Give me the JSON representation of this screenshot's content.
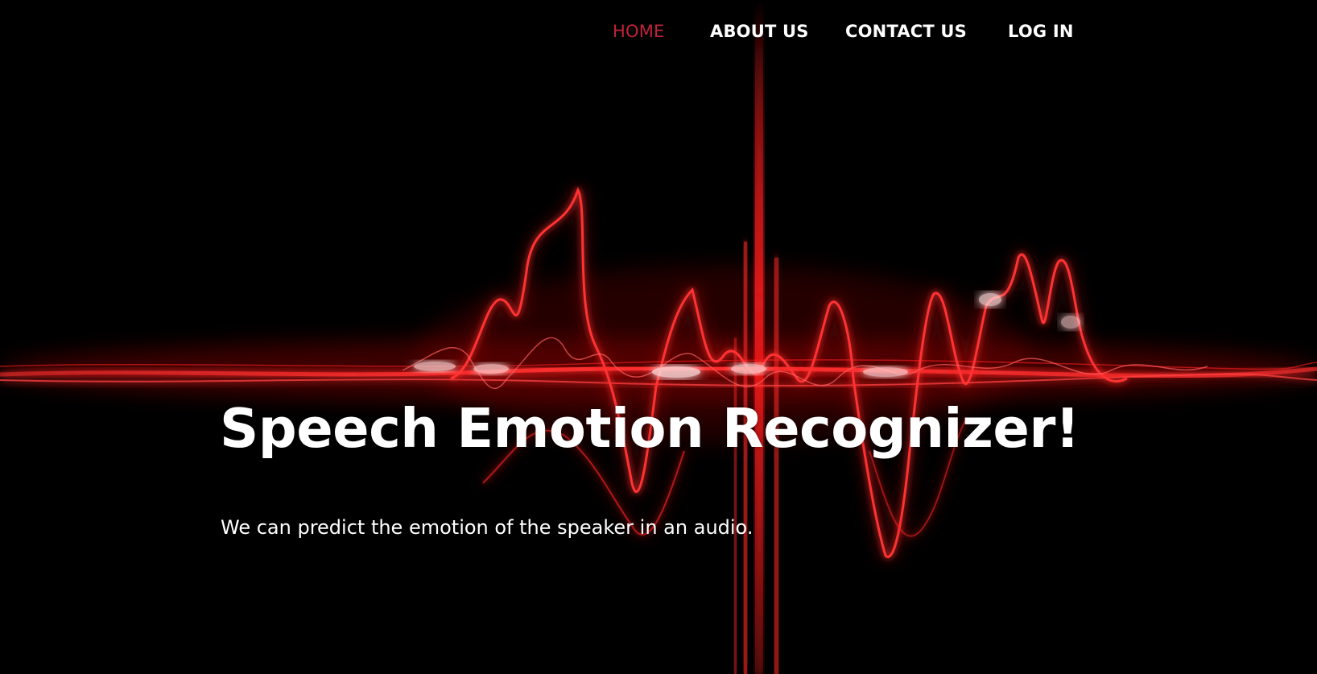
{
  "nav": {
    "items": [
      {
        "label": "HOME",
        "active": true
      },
      {
        "label": "ABOUT US",
        "active": false
      },
      {
        "label": "CONTACT US",
        "active": false
      },
      {
        "label": "LOG IN",
        "active": false
      }
    ]
  },
  "hero": {
    "title": "Speech Emotion Recognizer!",
    "subtitle": "We can predict the emotion of the speaker in an audio.",
    "background": "red-sound-wave-image"
  },
  "colors": {
    "background": "#000000",
    "accent": "#c0233a",
    "wave": "#ff1a1a",
    "text": "#ffffff"
  }
}
